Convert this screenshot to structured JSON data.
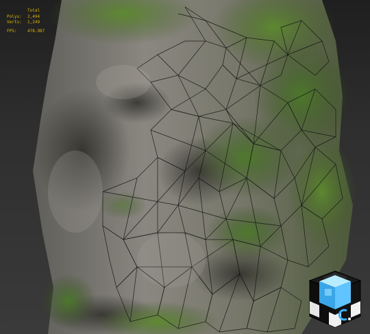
{
  "viewport": {
    "mode": "wireframe-over-textured",
    "subject": "mossy rock column"
  },
  "stats": {
    "header": "Total",
    "polys_label": "Polys:",
    "polys_value": "2,494",
    "verts_label": "Verts:",
    "verts_value": "1,249",
    "fps_label": "FPS:",
    "fps_value": "478.987"
  },
  "colors": {
    "stats_text": "#e0b400",
    "background": "#2e2e2e",
    "viewcube_accent": "#3ab4ff"
  },
  "icons": {
    "viewcube": "navigation-cube-icon"
  }
}
